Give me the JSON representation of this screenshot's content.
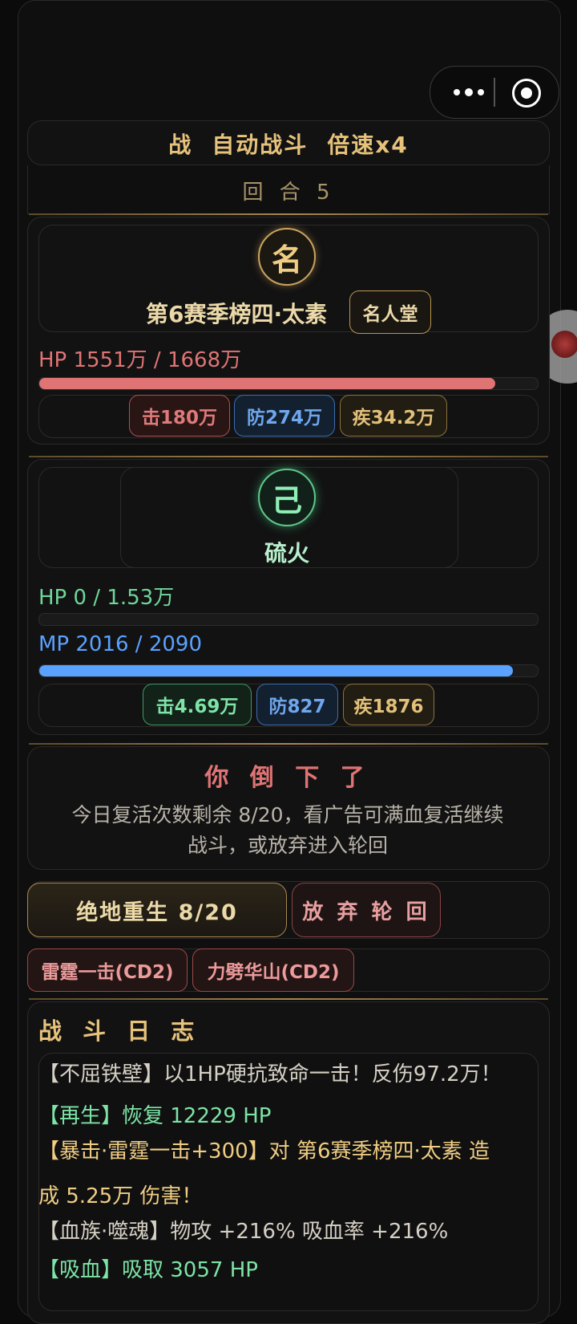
{
  "header": {
    "battle_label": "战",
    "auto_label": "自动战斗",
    "speed_label": "倍速x4",
    "round_label": "回 合 5"
  },
  "enemy": {
    "badge": "名",
    "name": "第6赛季榜四·太素",
    "tag": "名人堂",
    "hp_text": "HP  1551万 / 1668万",
    "hp_fraction": 0.93,
    "attack": "击180万",
    "defense": "防274万",
    "speed": "疾34.2万"
  },
  "player": {
    "badge": "己",
    "name": "硫火",
    "hp_text": "HP  0 / 1.53万",
    "hp_fraction": 0.0,
    "mp_text": "MP  2016 / 2090",
    "mp_fraction": 0.965,
    "attack": "击4.69万",
    "defense": "防827",
    "speed": "疾1876"
  },
  "defeat": {
    "title": "你 倒 下 了",
    "line1": "今日复活次数剩余 8/20，看广告可满血复活继续",
    "line2": "战斗，或放弃进入轮回"
  },
  "actions": {
    "revive": "绝地重生 8/20",
    "give_up": "放 弃 轮 回",
    "skill1": "雷霆一击(CD2)",
    "skill2": "力劈华山(CD2)"
  },
  "log": {
    "title": "战 斗 日 志",
    "lines": [
      "【不屈铁壁】以1HP硬抗致命一击！反伤97.2万！",
      "【再生】恢复 12229 HP",
      "【暴击·雷霆一击+300】对 第6赛季榜四·太素 造",
      "成 5.25万 伤害！",
      "【血族·噬魂】物攻 +216% 吸血率 +216%",
      "【吸血】吸取 3057 HP"
    ]
  },
  "colors": {
    "gold": "#e6c27a",
    "hp_red": "#e07474",
    "hp_green": "#6fd79a",
    "mp_blue": "#5aa2ff"
  }
}
